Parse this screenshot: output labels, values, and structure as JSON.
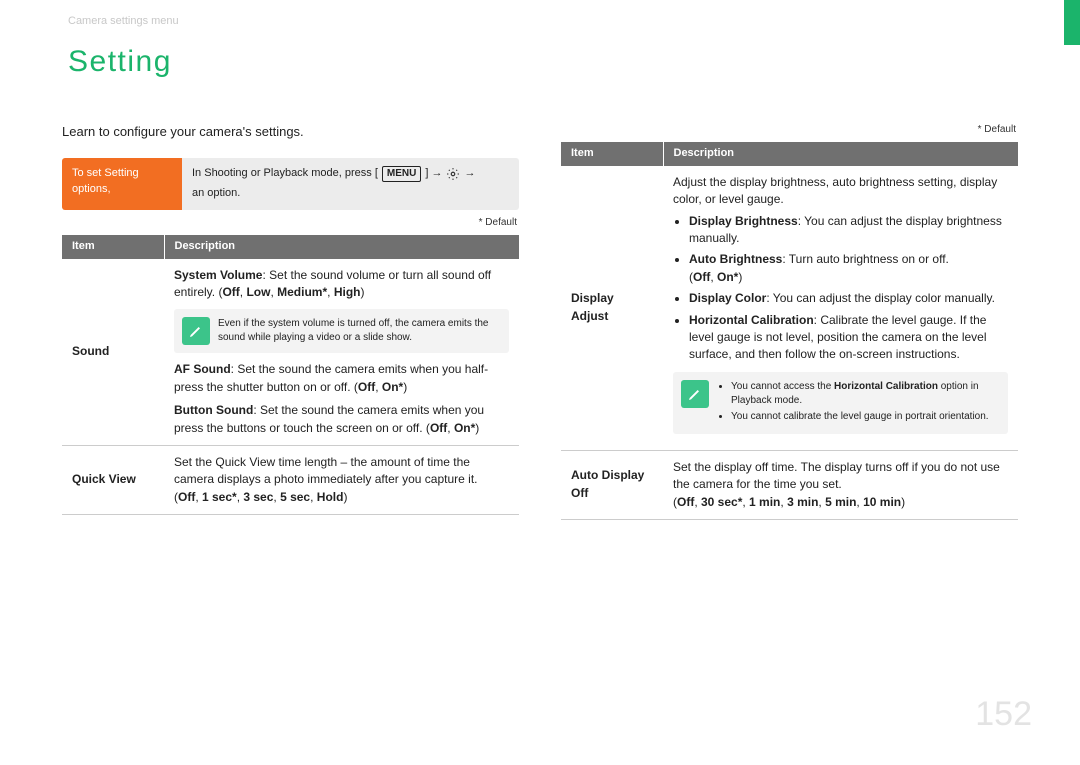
{
  "breadcrumb": "Camera settings menu",
  "title": "Setting",
  "intro": "Learn to configure your camera's settings.",
  "instruction": {
    "left": "To set Setting options,",
    "pre": "In Shooting or Playback mode, press [",
    "menu_label": "MENU",
    "mid1": "] →",
    "mid2": "→",
    "post": "an option."
  },
  "default_label": "* Default",
  "left_table": {
    "head_item": "Item",
    "head_desc": "Description",
    "rows": {
      "sound": {
        "item": "Sound",
        "sys_label": "System Volume",
        "sys_desc": ": Set the sound volume or turn all sound off entirely. (",
        "opt_off": "Off",
        "opt_low": "Low",
        "opt_medium": "Medium*",
        "opt_high": "High",
        "close": ")",
        "note": "Even if the system volume is turned off, the camera emits the sound while playing a video or a slide show.",
        "af_label": "AF Sound",
        "af_desc": ": Set the sound the camera emits when you half-press the shutter button on or off. (",
        "on_star": "On*",
        "btn_label": "Button Sound",
        "btn_desc": ": Set the sound the camera emits when you press the buttons or touch the screen on or off. ("
      },
      "quickview": {
        "item": "Quick View",
        "desc": "Set the Quick View time length – the amount of time the camera displays a photo immediately after you capture it.",
        "opts_open": "(",
        "opt_off": "Off",
        "opt_1s": "1 sec*",
        "opt_3s": "3 sec",
        "opt_5s": "5 sec",
        "opt_hold": "Hold",
        "opts_close": ")"
      }
    }
  },
  "right_table": {
    "head_item": "Item",
    "head_desc": "Description",
    "rows": {
      "display_adjust": {
        "item": "Display Adjust",
        "lead": "Adjust the display brightness, auto brightness setting, display color, or level gauge.",
        "db_label": "Display Brightness",
        "db_desc": ": You can adjust the display brightness manually.",
        "ab_label": "Auto Brightness",
        "ab_desc": ": Turn auto brightness on or off.",
        "ab_opts_open": "(",
        "opt_off": "Off",
        "opt_on_star": "On*",
        "ab_opts_close": ")",
        "dc_label": "Display Color",
        "dc_desc": ": You can adjust the display color manually.",
        "hc_label": "Horizontal Calibration",
        "hc_desc": ": Calibrate the level gauge. If the level gauge is not level, position the camera on the level surface, and then follow the on-screen instructions.",
        "note_line1_pre": "You cannot access the ",
        "note_line1_bold": "Horizontal Calibration",
        "note_line1_post": " option in Playback mode.",
        "note_line2": "You cannot calibrate the level gauge in portrait orientation."
      },
      "auto_display_off": {
        "item": "Auto Display Off",
        "desc": "Set the display off time. The display turns off if you do not use the camera for the time you set.",
        "opts_open": "(",
        "o_off": "Off",
        "o_30s": "30 sec*",
        "o_1m": "1 min",
        "o_3m": "3 min",
        "o_5m": "5 min",
        "o_10m": "10 min",
        "opts_close": ")"
      }
    }
  },
  "page_number": "152"
}
